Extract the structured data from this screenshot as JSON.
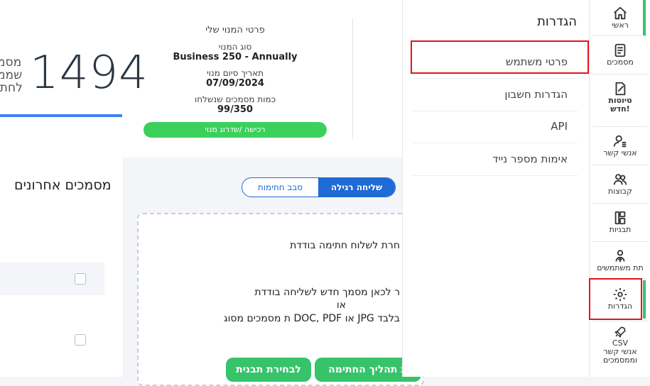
{
  "plan": {
    "header": "פרטי המנוי שלי",
    "type_label": "סוג המנוי",
    "type_value": "Business 250 - Annually",
    "end_label": "תאריך סיום מנוי",
    "end_value": "07/09/2024",
    "docs_label": "כמות מסמכים שנשלחו",
    "docs_value": "99/350",
    "upgrade_label": "רכישה /שדרוג מנוי"
  },
  "stats": {
    "count": "1494",
    "frag_1": "מסמ",
    "frag_2": "שממ",
    "frag_3": "לחתי"
  },
  "tabs": {
    "regular": "שליחה רגילה",
    "round": "סבב חתימות"
  },
  "dropzone": {
    "line1": "חרת לשלוח חתימה בודדת",
    "line2": "ר לכאן מסמך חדש לשליחה בודדת",
    "line3": "או",
    "line4": "ת מסמכים מסוג DOC, PDF או JPG בלבד",
    "btn_process": "ת תהליך החתימה",
    "btn_template": "לבחירת תבנית"
  },
  "recent": {
    "title": "מסמכים אחרונים"
  },
  "flyout": {
    "title": "הגדרות",
    "items": [
      "פרטי משתמש",
      "הגדרות חשבון",
      "API",
      "אימות מספר נייד"
    ]
  },
  "sidebar": {
    "items": [
      {
        "label": "ראשי",
        "icon": "home-icon"
      },
      {
        "label": "מסמכים",
        "icon": "documents-icon"
      },
      {
        "label": "טיוטות",
        "label2": "חדש!",
        "icon": "drafts-icon"
      },
      {
        "label": "אנשי קשר",
        "icon": "contacts-icon"
      },
      {
        "label": "קבוצות",
        "icon": "groups-icon"
      },
      {
        "label": "תבניות",
        "icon": "templates-icon"
      },
      {
        "label": "תת משתמשים",
        "icon": "sub-users-icon"
      },
      {
        "label": "הגדרות",
        "icon": "settings-icon"
      },
      {
        "label": "CSV",
        "label2": "אנשי קשר",
        "label3": "וממסמכים",
        "icon": "csv-icon"
      }
    ]
  },
  "colors": {
    "accent_blue": "#1e6bd6",
    "accent_green": "#36c36a",
    "highlight_red": "#e5141b"
  }
}
